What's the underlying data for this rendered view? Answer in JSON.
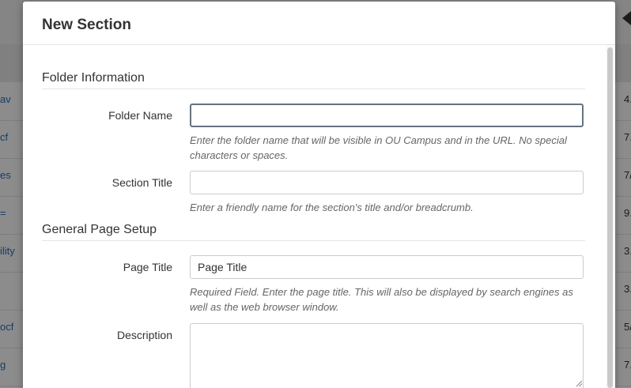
{
  "background": {
    "rows": [
      {
        "left": "av",
        "right": "4."
      },
      {
        "left": "cf",
        "right": "7."
      },
      {
        "left": "es",
        "right": "7/"
      },
      {
        "left": "=",
        "right": "9."
      },
      {
        "left": "ility",
        "right": "3."
      },
      {
        "left": "",
        "right": "3."
      },
      {
        "left": "ocf",
        "right": "5/"
      },
      {
        "left": "g",
        "right": "7."
      }
    ]
  },
  "modal": {
    "title": "New Section",
    "folder_information": {
      "legend": "Folder Information",
      "folder_name": {
        "label": "Folder Name",
        "value": "",
        "help": "Enter the folder name that will be visible in OU Campus and in the URL. No special characters or spaces."
      },
      "section_title": {
        "label": "Section Title",
        "value": "",
        "help": "Enter a friendly name for the section's title and/or breadcrumb."
      }
    },
    "general_page_setup": {
      "legend": "General Page Setup",
      "page_title": {
        "label": "Page Title",
        "value": "Page Title",
        "help": "Required Field. Enter the page title. This will also be displayed by search engines as well as the web browser window."
      },
      "description": {
        "label": "Description",
        "value": ""
      }
    }
  },
  "colors": {
    "link": "#2a6ebb",
    "focus_border": "#66737f",
    "help_text": "#666666"
  }
}
